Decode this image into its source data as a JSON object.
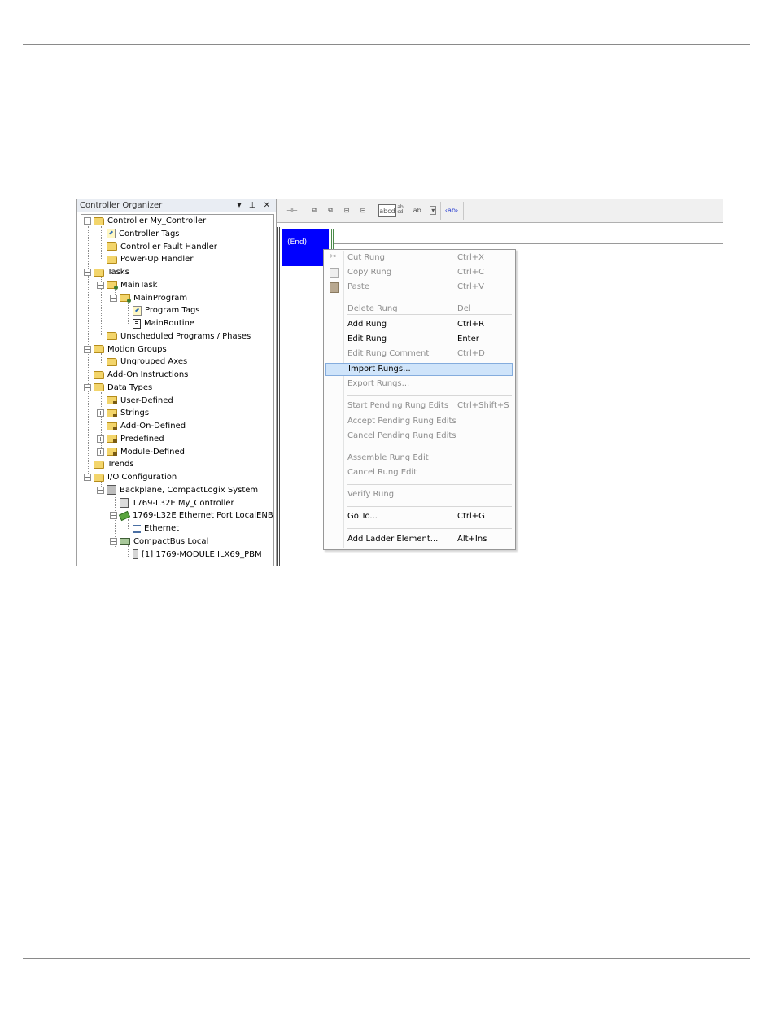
{
  "organizer": {
    "title": "Controller Organizer",
    "title_icons": "▾ ⊥ ✕",
    "tree": [
      {
        "label": "Controller My_Controller",
        "icon": "folder-icon",
        "expander": "−"
      },
      {
        "label": "Controller Tags",
        "icon": "tags-icon",
        "expander": ""
      },
      {
        "label": "Controller Fault Handler",
        "icon": "folder-icon",
        "expander": ""
      },
      {
        "label": "Power-Up Handler",
        "icon": "folder-icon",
        "expander": ""
      },
      {
        "label": "Tasks",
        "icon": "folder-icon",
        "expander": "−"
      },
      {
        "label": "MainTask",
        "icon": "task-icon",
        "expander": "−"
      },
      {
        "label": "MainProgram",
        "icon": "program-icon",
        "expander": "−"
      },
      {
        "label": "Program Tags",
        "icon": "tags-icon",
        "expander": ""
      },
      {
        "label": "MainRoutine",
        "icon": "routine-icon",
        "expander": ""
      },
      {
        "label": "Unscheduled Programs / Phases",
        "icon": "folder-icon",
        "expander": ""
      },
      {
        "label": "Motion Groups",
        "icon": "folder-icon",
        "expander": "−"
      },
      {
        "label": "Ungrouped Axes",
        "icon": "folder-icon",
        "expander": ""
      },
      {
        "label": "Add-On Instructions",
        "icon": "folder-icon",
        "expander": ""
      },
      {
        "label": "Data Types",
        "icon": "folder-icon",
        "expander": "−"
      },
      {
        "label": "User-Defined",
        "icon": "datatype-icon",
        "expander": ""
      },
      {
        "label": "Strings",
        "icon": "datatype-icon",
        "expander": "+"
      },
      {
        "label": "Add-On-Defined",
        "icon": "datatype-icon",
        "expander": ""
      },
      {
        "label": "Predefined",
        "icon": "datatype-icon",
        "expander": "+"
      },
      {
        "label": "Module-Defined",
        "icon": "datatype-icon",
        "expander": "+"
      },
      {
        "label": "Trends",
        "icon": "folder-icon",
        "expander": ""
      },
      {
        "label": "I/O Configuration",
        "icon": "folder-icon",
        "expander": "−"
      },
      {
        "label": "Backplane, CompactLogix System",
        "icon": "rack-icon",
        "expander": "−"
      },
      {
        "label": "1769-L32E My_Controller",
        "icon": "cpu-icon",
        "expander": ""
      },
      {
        "label": "1769-L32E Ethernet Port LocalENB",
        "icon": "ethernet-port-icon",
        "expander": "−"
      },
      {
        "label": "Ethernet",
        "icon": "network-icon",
        "expander": ""
      },
      {
        "label": "CompactBus Local",
        "icon": "bus-icon",
        "expander": "−"
      },
      {
        "label": "[1] 1769-MODULE ILX69_PBM",
        "icon": "module-icon",
        "expander": ""
      }
    ]
  },
  "toolbar": {
    "btn1": "⊣⊢",
    "btn2": "⧉",
    "btn3": "⧉",
    "btn4": "⊟",
    "btn5": "⊟",
    "btn_abcd": "abcd",
    "btn_abcd2": "ab\ncd",
    "combo": "ab...",
    "combo_arrow": "▾",
    "btn_ab": "‹ab›"
  },
  "editor": {
    "end_label": "(End)"
  },
  "context_menu": {
    "items": [
      {
        "label": "Cut Rung",
        "shortcut": "Ctrl+X",
        "disabled": true
      },
      {
        "label": "Copy Rung",
        "shortcut": "Ctrl+C",
        "disabled": true
      },
      {
        "label": "Paste",
        "shortcut": "Ctrl+V",
        "disabled": true
      },
      {
        "label": "Delete Rung",
        "shortcut": "Del",
        "disabled": true
      },
      {
        "label": "Add Rung",
        "shortcut": "Ctrl+R",
        "disabled": false
      },
      {
        "label": "Edit Rung",
        "shortcut": "Enter",
        "disabled": false
      },
      {
        "label": "Edit Rung Comment",
        "shortcut": "Ctrl+D",
        "disabled": true
      },
      {
        "label": "Import Rungs...",
        "shortcut": "",
        "disabled": false,
        "highlighted": true
      },
      {
        "label": "Export Rungs...",
        "shortcut": "",
        "disabled": true
      },
      {
        "label": "Start Pending Rung Edits",
        "shortcut": "Ctrl+Shift+S",
        "disabled": true
      },
      {
        "label": "Accept Pending Rung Edits",
        "shortcut": "",
        "disabled": true
      },
      {
        "label": "Cancel Pending Rung Edits",
        "shortcut": "",
        "disabled": true
      },
      {
        "label": "Assemble Rung Edit",
        "shortcut": "",
        "disabled": true
      },
      {
        "label": "Cancel Rung Edit",
        "shortcut": "",
        "disabled": true
      },
      {
        "label": "Verify Rung",
        "shortcut": "",
        "disabled": true
      },
      {
        "label": "Go To...",
        "shortcut": "Ctrl+G",
        "disabled": false
      },
      {
        "label": "Add Ladder Element...",
        "shortcut": "Alt+Ins",
        "disabled": false
      }
    ]
  },
  "colors": {
    "end_rung_bg": "#0000ff",
    "menu_highlight": "#cfe4fa",
    "disabled_text": "#8d8d8d"
  }
}
